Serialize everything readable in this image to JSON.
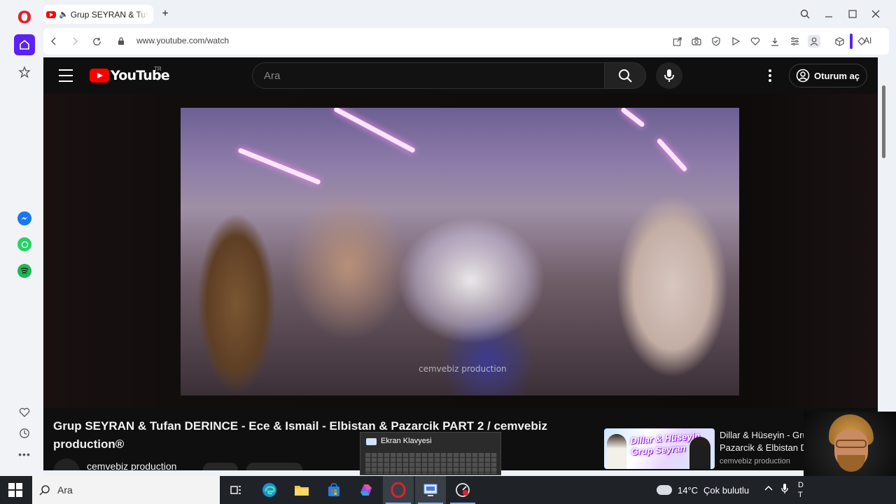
{
  "browser": {
    "tab_title": "Grup SEYRAN & Tufan DERINCE",
    "url": "www.youtube.com/watch",
    "ai_label": "AI",
    "new_tab": "+"
  },
  "youtube": {
    "logo_text": "YouTube",
    "country_code": "TR",
    "search_placeholder": "Ara",
    "signin_label": "Oturum aç"
  },
  "video": {
    "watermark": "cemvebiz production",
    "title": "Grup SEYRAN & Tufan DERINCE - Ece & Ismail - Elbistan & Pazarcik PART 2 / cemvebiz production®",
    "channel": "cemvebiz production"
  },
  "recommendation": {
    "thumb_text": "Dillar & Hüseyin Grup Seyran",
    "title_line1": "Dillar & Hüseyin - Grup",
    "title_line2": "Pazarcik & Elbistan D",
    "channel": "cemvebiz production"
  },
  "popup": {
    "title": "Ekran Klavyesi"
  },
  "taskbar": {
    "search_placeholder": "Ara",
    "temperature": "14°C",
    "condition": "Çok bulutlu",
    "tray_letter_1": "D",
    "tray_letter_2": "T"
  },
  "colors": {
    "opera_accent": "#5b21f5",
    "youtube_red": "#ff0000",
    "youtube_bg": "#0f0f0f"
  }
}
